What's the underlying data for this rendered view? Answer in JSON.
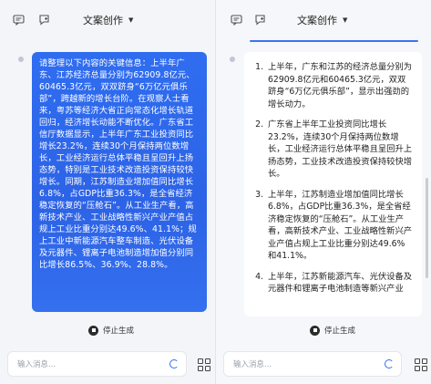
{
  "left": {
    "title": "文案创作",
    "message": "请整理以下内容的关键信息：上半年广东、江苏经济总量分别为62909.8亿元、60465.3亿元，双双跻身“6万亿元俱乐部”，跨越新的增长台阶。在观察人士看来，粤苏等经济大省正向常态化增长轨道回归，经济增长动能不断优化。广东省工信厅数据显示，上半年广东工业投资同比增长23.2%，连续30个月保持两位数增长，工业经济运行总体平稳且呈回升上扬态势，特别是工业技术改造投资保持较快增长。同期，江苏制造业增加值同比增长6.8%，占GDP比重36.3%，是全省经济稳定恢复的“压舱石”。从工业生产看，高新技术产业、工业战略性新兴产业产值占规上工业比重分别达49.6%、41.1%；规上工业中新能源汽车整车制造、光伏设备及元器件、锂离子电池制造增加值分别同比增长86.5%、36.9%、28.8%。",
    "stop_label": "停止生成",
    "input_placeholder": "输入消息..."
  },
  "right": {
    "title": "文案创作",
    "items": [
      "上半年，广东和江苏的经济总量分别为62909.8亿元和60465.3亿元，双双跻身“6万亿元俱乐部”，显示出强劲的增长动力。",
      "广东省上半年工业投资同比增长23.2%，连续30个月保持两位数增长，工业经济运行总体平稳且呈回升上扬态势，工业技术改造投资保持较快增长。",
      "上半年，江苏制造业增加值同比增长6.8%，占GDP比重36.3%，是全省经济稳定恢复的“压舱石”。从工业生产看，高新技术产业、工业战略性新兴产业产值占规上工业比重分别达49.6%和41.1%。",
      "上半年，江苏新能源汽车、光伏设备及元器件和锂离子电池制造等新兴产业"
    ],
    "stop_label": "停止生成",
    "input_placeholder": "输入消息..."
  },
  "icons": {
    "history": "history-icon",
    "new_chat": "new-chat-icon",
    "stop": "stop-icon",
    "loading": "loading-spinner-icon",
    "apps": "apps-grid-icon"
  },
  "colors": {
    "accent": "#2f6df0",
    "background": "#f4f5f8",
    "bubble_text": "#ffffff"
  }
}
